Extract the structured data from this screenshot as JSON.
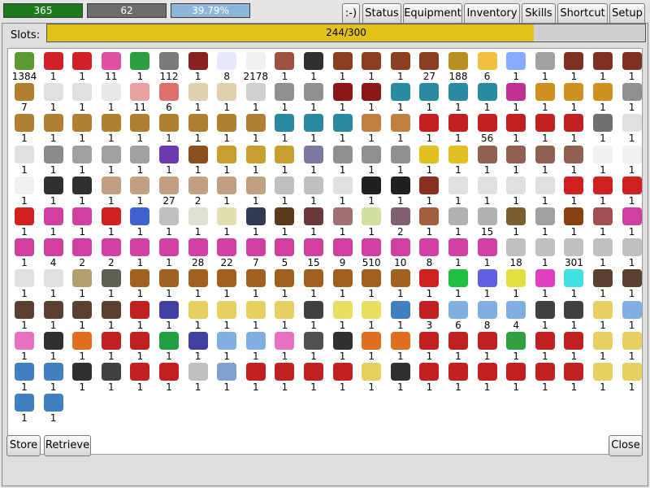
{
  "status_bars": {
    "hp": {
      "label": "365",
      "fill": 1.0
    },
    "mp": {
      "label": "62",
      "fill": 1.0
    },
    "xp": {
      "label": "39.79%",
      "fill": 1.0
    }
  },
  "top_buttons": [
    {
      "label": ":-)"
    },
    {
      "label": "Status"
    },
    {
      "label": "Equipment"
    },
    {
      "label": "Inventory"
    },
    {
      "label": "Skills"
    },
    {
      "label": "Shortcut"
    },
    {
      "label": "Setup"
    }
  ],
  "storage": {
    "slots_label": "Slots:",
    "slots_text": "244/300",
    "slots_fill": 0.8133,
    "store_button": "Store",
    "retrieve_button": "Retrieve",
    "close_button": "Close",
    "rows": [
      {
        "qty": [
          "1384",
          "1",
          "1",
          "11",
          "1",
          "112",
          "1",
          "8",
          "2178",
          "1",
          "1",
          "1",
          "1",
          "1",
          "27",
          "188",
          "6",
          "1",
          "1",
          "1",
          "1",
          "1"
        ],
        "icons": [
          "#5a9a2e",
          "#d0202a",
          "#d0202a",
          "#e050a0",
          "#2aa040",
          "#7a7a7a",
          "#8a2020",
          "#e8e8ff",
          "#f0f0f0",
          "#a05040",
          "#303030",
          "#8a4020",
          "#8a4020",
          "#8a4020",
          "#8a4020",
          "#b89020",
          "#f0c040",
          "#88aaff",
          "#a0a0a0",
          "#803020",
          "#803020",
          "#803020"
        ]
      },
      {
        "qty": [
          "7",
          "1",
          "1",
          "1",
          "11",
          "6",
          "1",
          "1",
          "1",
          "1",
          "1",
          "1",
          "1",
          "1",
          "1",
          "1",
          "1",
          "1",
          "1",
          "1",
          "1",
          "1"
        ],
        "icons": [
          "#b08030",
          "#e0e0e0",
          "#e0e0e0",
          "#e8e8e8",
          "#e8a0a0",
          "#e07070",
          "#e0d0b0",
          "#e0d0b0",
          "#d0d0d0",
          "#909090",
          "#909090",
          "#8a1818",
          "#8a1818",
          "#2a8aa0",
          "#2a8aa0",
          "#2a8aa0",
          "#2a8aa0",
          "#c03090",
          "#d09020",
          "#d09020",
          "#d09020",
          "#909090"
        ]
      },
      {
        "qty": [
          "1",
          "1",
          "1",
          "1",
          "1",
          "1",
          "1",
          "1",
          "1",
          "1",
          "1",
          "1",
          "1",
          "1",
          "1",
          "1",
          "56",
          "1",
          "1",
          "1",
          "1",
          "1"
        ],
        "icons": [
          "#b08030",
          "#b08030",
          "#b08030",
          "#b08030",
          "#b08030",
          "#b08030",
          "#b08030",
          "#b08030",
          "#b08030",
          "#2a8aa0",
          "#2a8aa0",
          "#2a8aa0",
          "#c08040",
          "#c08040",
          "#c02020",
          "#c02020",
          "#c02020",
          "#c02020",
          "#c02020",
          "#c02020",
          "#707070",
          "#e0e0e0"
        ]
      },
      {
        "qty": [
          "1",
          "1",
          "1",
          "1",
          "1",
          "1",
          "1",
          "1",
          "1",
          "1",
          "1",
          "1",
          "1",
          "1",
          "1",
          "1",
          "1",
          "1",
          "1",
          "1",
          "1",
          "1"
        ],
        "icons": [
          "#e0e0e0",
          "#8a8a8a",
          "#a0a0a0",
          "#a0a0a0",
          "#a0a0a0",
          "#6a3ab0",
          "#8a5020",
          "#c8a030",
          "#c8a030",
          "#c8a030",
          "#7a7aa0",
          "#909090",
          "#909090",
          "#909090",
          "#e0c020",
          "#e0c020",
          "#906050",
          "#906050",
          "#906050",
          "#906050",
          "#f0f0f0",
          "#f0f0f0"
        ]
      },
      {
        "qty": [
          "1",
          "1",
          "1",
          "1",
          "1",
          "27",
          "2",
          "1",
          "1",
          "1",
          "1",
          "1",
          "1",
          "1",
          "1",
          "1",
          "1",
          "1",
          "1",
          "1",
          "1",
          "1"
        ],
        "icons": [
          "#f0f0f0",
          "#303030",
          "#303030",
          "#c0a080",
          "#c0a080",
          "#c0a080",
          "#c0a080",
          "#c0a080",
          "#c0a080",
          "#c0c0c0",
          "#c0c0c0",
          "#e0e0e0",
          "#202020",
          "#202020",
          "#8a3020",
          "#e0e0e0",
          "#e0e0e0",
          "#e0e0e0",
          "#e0e0e0",
          "#d02020",
          "#d02020",
          "#d02020"
        ]
      },
      {
        "qty": [
          "1",
          "1",
          "1",
          "1",
          "1",
          "1",
          "1",
          "1",
          "1",
          "1",
          "1",
          "1",
          "1",
          "2",
          "1",
          "1",
          "15",
          "1",
          "1",
          "1",
          "1",
          "1"
        ],
        "icons": [
          "#d02020",
          "#d040a0",
          "#d040a0",
          "#d02020",
          "#4060d0",
          "#c0c0c0",
          "#e0e0d0",
          "#e0e0b0",
          "#303a50",
          "#5a3a1a",
          "#6a3a3a",
          "#a07070",
          "#d0e0a0",
          "#806070",
          "#a06040",
          "#b0b0b0",
          "#b0b0b0",
          "#7a6030",
          "#a0a0a0",
          "#8a4010",
          "#a05050",
          "#d040a0"
        ]
      },
      {
        "qty": [
          "1",
          "4",
          "2",
          "2",
          "1",
          "1",
          "28",
          "22",
          "7",
          "5",
          "15",
          "9",
          "510",
          "10",
          "8",
          "1",
          "1",
          "18",
          "1",
          "301",
          "1",
          "1"
        ],
        "icons": [
          "#d040a0",
          "#d040a0",
          "#d040a0",
          "#d040a0",
          "#d040a0",
          "#d040a0",
          "#d040a0",
          "#d040a0",
          "#d040a0",
          "#d040a0",
          "#d040a0",
          "#d040a0",
          "#d040a0",
          "#d040a0",
          "#d040a0",
          "#d040a0",
          "#d040a0",
          "#c0c0c0",
          "#c0c0c0",
          "#c0c0c0",
          "#c0c0c0",
          "#c0c0c0"
        ]
      },
      {
        "qty": [
          "1",
          "1",
          "1",
          "1",
          "1",
          "1",
          "1",
          "1",
          "1",
          "1",
          "1",
          "1",
          "1",
          "1",
          "1",
          "1",
          "1",
          "1",
          "1",
          "1",
          "1",
          "1"
        ],
        "icons": [
          "#e0e0e0",
          "#e0e0e0",
          "#b0a070",
          "#606050",
          "#a06020",
          "#a06020",
          "#a06020",
          "#a06020",
          "#a06020",
          "#a06020",
          "#a06020",
          "#a06020",
          "#a06020",
          "#a06020",
          "#d02020",
          "#20c040",
          "#6060e0",
          "#e0e040",
          "#e040c0",
          "#40e0e0",
          "#5a4030",
          "#5a4030"
        ]
      },
      {
        "qty": [
          "1",
          "1",
          "1",
          "1",
          "1",
          "1",
          "1",
          "1",
          "1",
          "1",
          "1",
          "1",
          "1",
          "1",
          "3",
          "6",
          "8",
          "4",
          "1",
          "1",
          "1",
          "1"
        ],
        "icons": [
          "#5a4030",
          "#5a4030",
          "#5a4030",
          "#5a4030",
          "#c02020",
          "#4040a0",
          "#e8d060",
          "#e8d060",
          "#e8d060",
          "#e8d060",
          "#404040",
          "#e8e060",
          "#e8e060",
          "#4080c0",
          "#c02020",
          "#80b0e0",
          "#80b0e0",
          "#80b0e0",
          "#404040",
          "#404040",
          "#e8d060",
          "#80b0e0"
        ]
      },
      {
        "qty": [
          "1",
          "1",
          "1",
          "1",
          "1",
          "1",
          "1",
          "1",
          "1",
          "1",
          "1",
          "1",
          "1",
          "1",
          "1",
          "1",
          "1",
          "1",
          "1",
          "1",
          "1",
          "1"
        ],
        "icons": [
          "#e870c0",
          "#303030",
          "#e07020",
          "#c02020",
          "#c02020",
          "#20a040",
          "#4040a0",
          "#80b0e0",
          "#80b0e0",
          "#e870c0",
          "#505050",
          "#303030",
          "#e07020",
          "#e07020",
          "#c02020",
          "#c02020",
          "#c02020",
          "#30a040",
          "#c02020",
          "#c02020",
          "#e8d060",
          "#e8d060"
        ]
      },
      {
        "qty": [
          "1",
          "1",
          "1",
          "1",
          "1",
          "1",
          "1",
          "1",
          "1",
          "1",
          "1",
          "1",
          "1",
          "1",
          "1",
          "1",
          "1",
          "1",
          "1",
          "1",
          "1",
          "1"
        ],
        "icons": [
          "#4080c0",
          "#4080c0",
          "#303030",
          "#404040",
          "#c02020",
          "#c02020",
          "#c0c0c0",
          "#80a0d0",
          "#c02020",
          "#c02020",
          "#c02020",
          "#c02020",
          "#e8d060",
          "#303030",
          "#c02020",
          "#c02020",
          "#c02020",
          "#c02020",
          "#c02020",
          "#c02020",
          "#e8d060",
          "#e8d060"
        ]
      },
      {
        "qty": [
          "1",
          "1"
        ],
        "icons": [
          "#4080c0",
          "#4080c0"
        ]
      }
    ]
  }
}
